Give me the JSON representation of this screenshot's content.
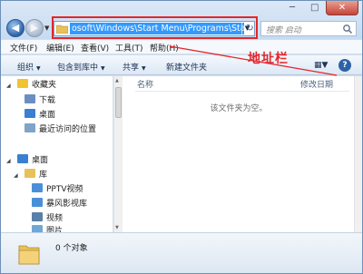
{
  "window": {
    "minimize": "─",
    "maximize": "□",
    "close": "✕"
  },
  "nav": {
    "back": "◀",
    "forward": "▶",
    "history": "▼"
  },
  "address": {
    "path": "osoft\\Windows\\Start Menu\\Programs\\Startup",
    "dropdown": "▼",
    "refresh": "↻"
  },
  "search": {
    "placeholder": "搜索 启动"
  },
  "menubar": {
    "items": [
      "文件(F)",
      "编辑(E)",
      "查看(V)",
      "工具(T)",
      "帮助(H)"
    ]
  },
  "callout": {
    "label": "地址栏",
    "color": "#e3262b"
  },
  "toolbar": {
    "organize": "组织",
    "include_library": "包含到库中",
    "share": "共享",
    "new_folder": "新建文件夹",
    "help": "?"
  },
  "sidebar": {
    "favorites": "收藏夹",
    "favorites_items": [
      "下载",
      "桌面",
      "最近访问的位置"
    ],
    "desktop": "桌面",
    "library": "库",
    "library_items": [
      "PPTV视频",
      "暴风影视库",
      "视频",
      "图片"
    ]
  },
  "content": {
    "col_name": "名称",
    "col_modified": "修改日期",
    "empty_message": "该文件夹为空。"
  },
  "details": {
    "count": "0 个对象"
  },
  "colors": {
    "accent": "#2d62a8",
    "selection": "#3399ff",
    "folder": "#e8c15a"
  }
}
